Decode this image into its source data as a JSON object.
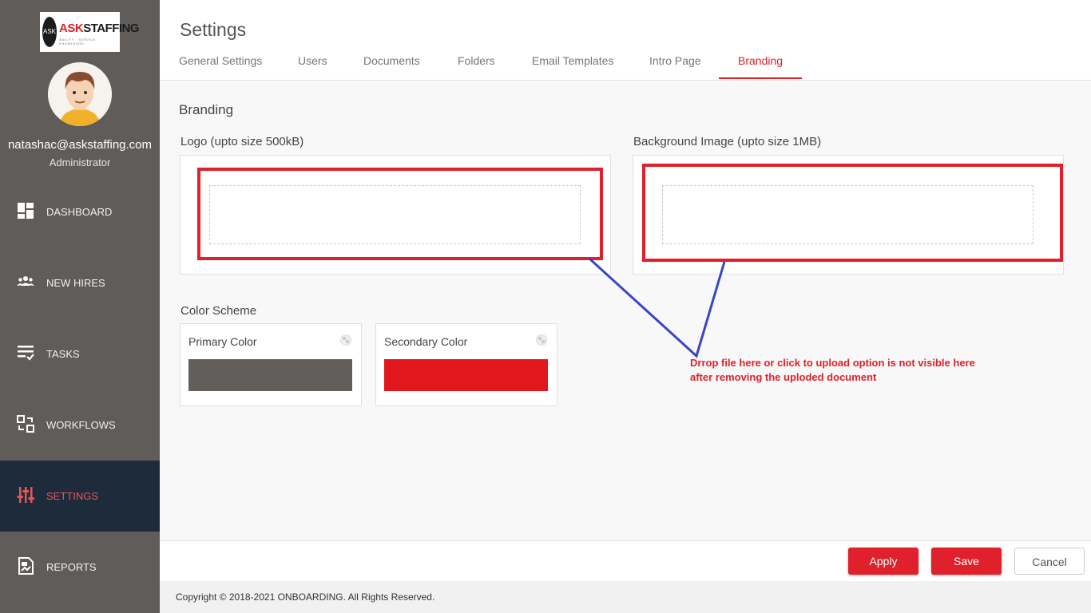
{
  "brand": {
    "logo_mark": "ASK",
    "logo_text_red": "ASK",
    "logo_text_dark": "STAFFING",
    "logo_tagline": "ABILITY · SERVICE · KNOWLEDGE"
  },
  "user": {
    "email": "natashac@askstaffing.com",
    "role": "Administrator"
  },
  "sidebar": {
    "items": [
      {
        "label": "DASHBOARD",
        "icon": "dashboard-icon"
      },
      {
        "label": "NEW HIRES",
        "icon": "people-icon"
      },
      {
        "label": "TASKS",
        "icon": "tasks-icon"
      },
      {
        "label": "WORKFLOWS",
        "icon": "workflows-icon"
      },
      {
        "label": "SETTINGS",
        "icon": "sliders-icon",
        "active": true
      },
      {
        "label": "REPORTS",
        "icon": "reports-icon"
      }
    ]
  },
  "header": {
    "title": "Settings",
    "tabs": [
      {
        "label": "General Settings"
      },
      {
        "label": "Users"
      },
      {
        "label": "Documents"
      },
      {
        "label": "Folders"
      },
      {
        "label": "Email Templates"
      },
      {
        "label": "Intro Page"
      },
      {
        "label": "Branding",
        "active": true
      }
    ]
  },
  "branding": {
    "section_title": "Branding",
    "logo_label": "Logo (upto size 500kB)",
    "background_label": "Background Image (upto size 1MB)",
    "color_scheme_label": "Color Scheme",
    "primary_label": "Primary Color",
    "primary_color": "#625e5c",
    "secondary_label": "Secondary Color",
    "secondary_color": "#e0181e"
  },
  "annotation": {
    "line1": "Drrop file here or click to upload option is not visible here",
    "line2": "after removing the uploded document"
  },
  "actions": {
    "apply": "Apply",
    "save": "Save",
    "cancel": "Cancel"
  },
  "footer": {
    "copyright": "Copyright © 2018-2021 ONBOARDING. All Rights Reserved."
  },
  "colors": {
    "accent": "#e0202a",
    "sidebar_bg": "#605c5a",
    "sidebar_active_bg": "#1e2b3a",
    "annotation_line": "#3a45c4"
  }
}
